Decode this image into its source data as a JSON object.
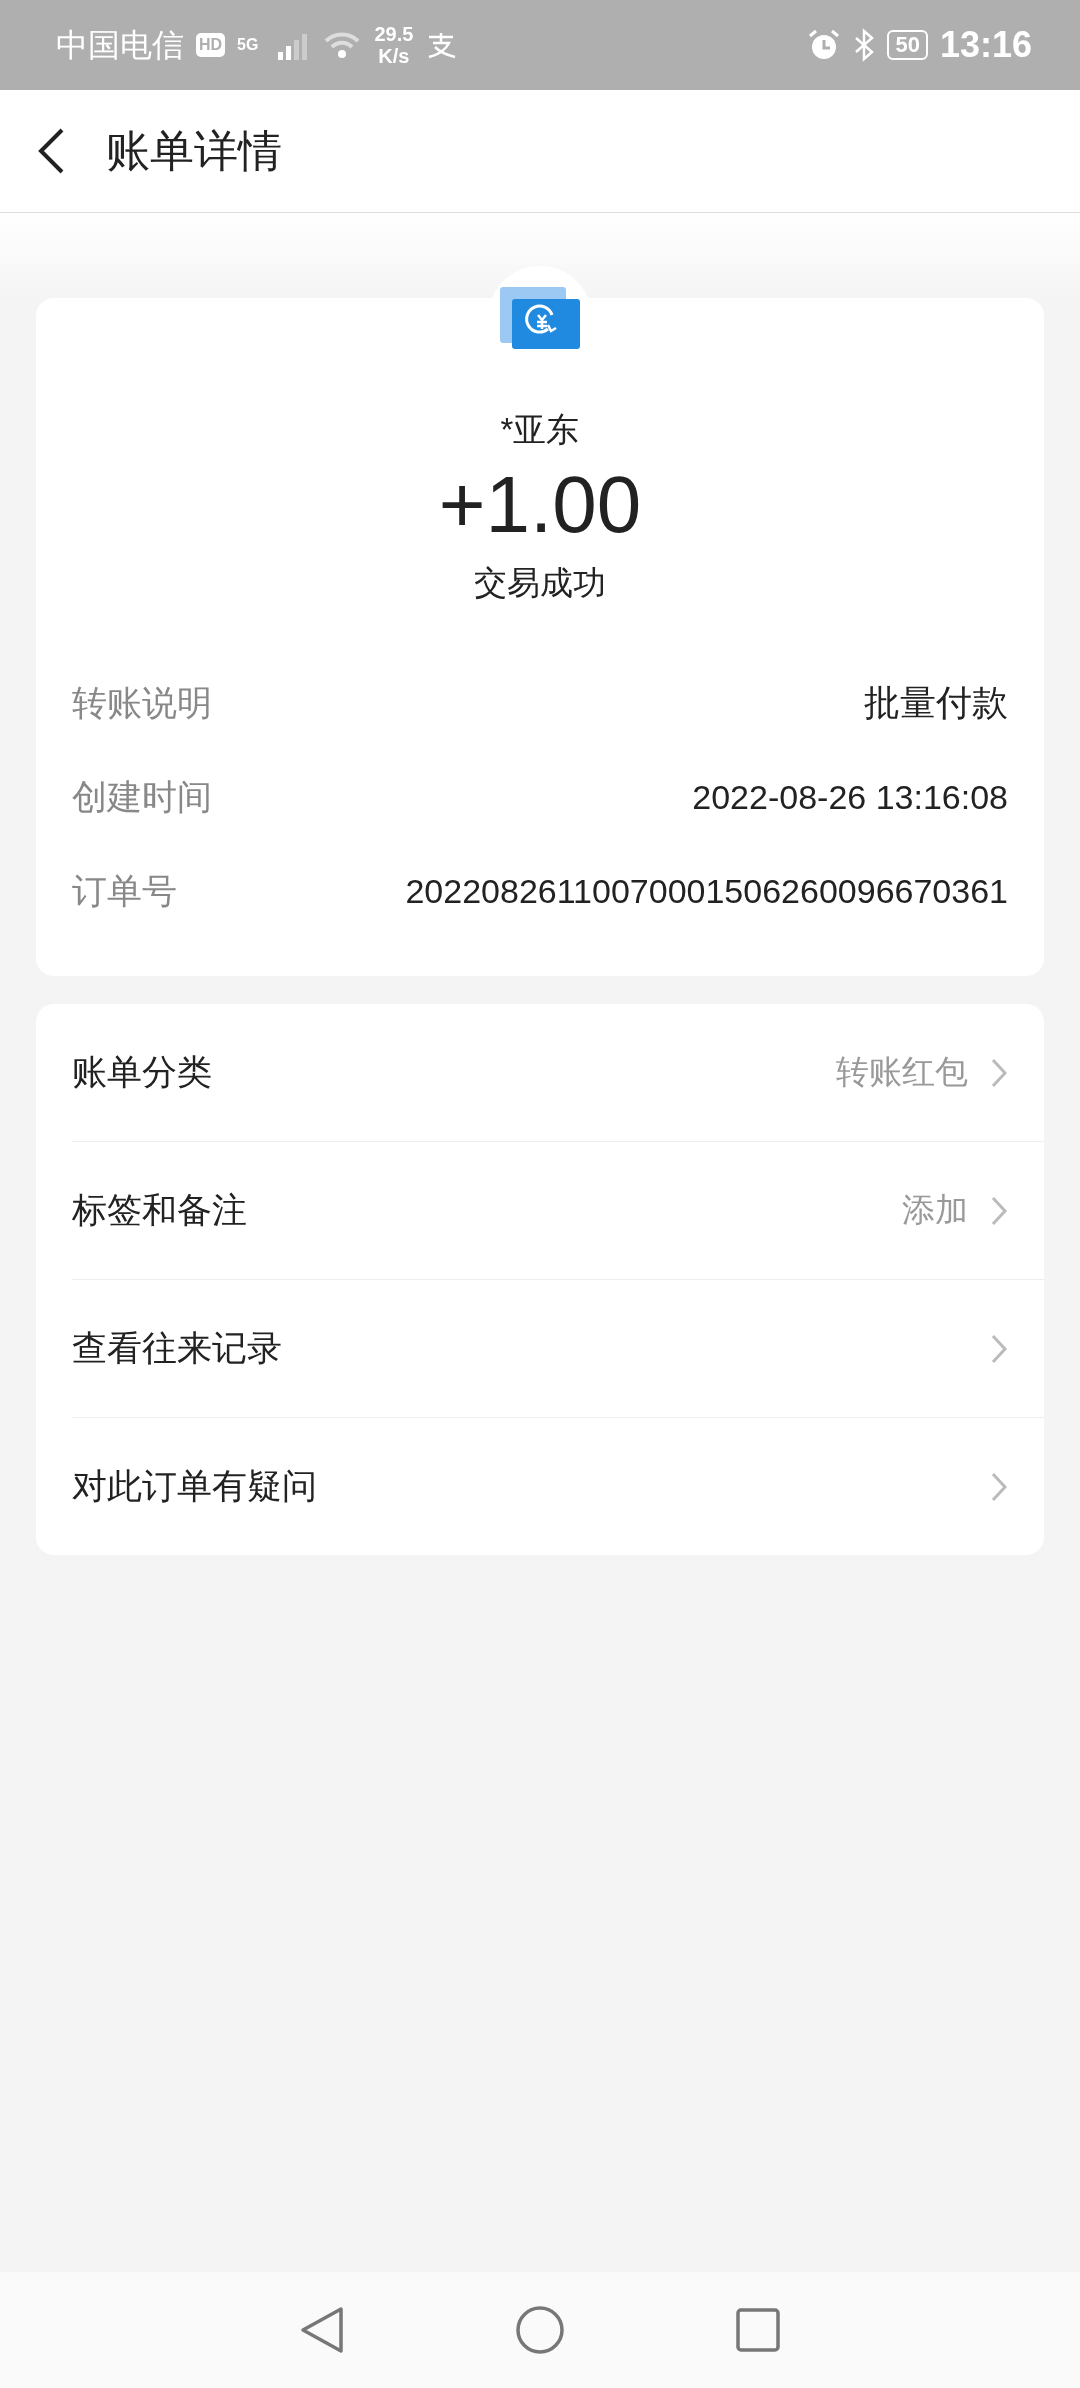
{
  "status_bar": {
    "carrier": "中国电信",
    "hd_badge": "HD",
    "network": "5G",
    "speed": "29.5",
    "speed_unit": "K/s",
    "battery": "50",
    "time": "13:16"
  },
  "header": {
    "title": "账单详情"
  },
  "summary": {
    "name": "*亚东",
    "amount": "+1.00",
    "status": "交易成功"
  },
  "details": [
    {
      "label": "转账说明",
      "value": "批量付款",
      "emphasis": true
    },
    {
      "label": "创建时间",
      "value": "2022-08-26 13:16:08",
      "emphasis": false
    },
    {
      "label": "订单号",
      "value": "20220826110070001506260096670361",
      "emphasis": false
    }
  ],
  "actions": [
    {
      "label": "账单分类",
      "value": "转账红包"
    },
    {
      "label": "标签和备注",
      "value": "添加"
    },
    {
      "label": "查看往来记录"
    },
    {
      "label": "对此订单有疑问"
    }
  ]
}
